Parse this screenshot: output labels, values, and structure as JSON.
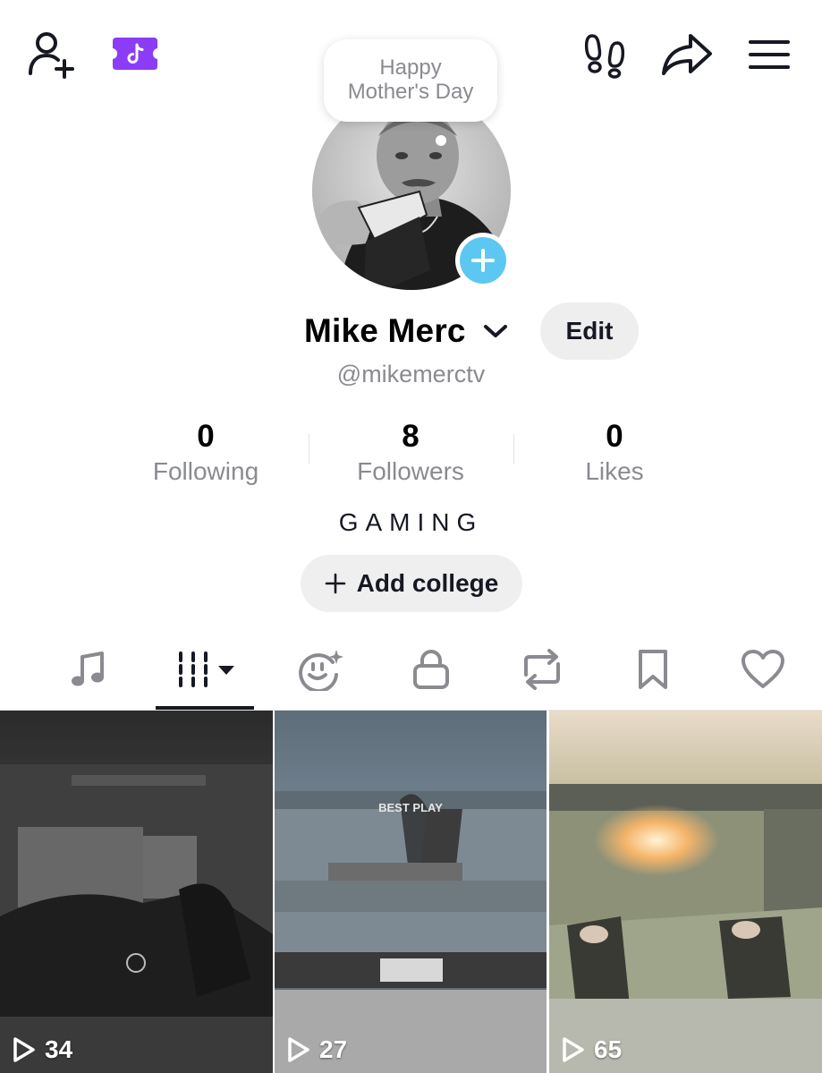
{
  "header": {
    "add_friend_icon": "person-plus-icon",
    "badge_icon": "tiktok-ticket-icon",
    "footprints_icon": "footprints-icon",
    "share_icon": "share-arrow-icon",
    "menu_icon": "hamburger-menu-icon"
  },
  "note_bubble": {
    "line1": "Happy",
    "line2": "Mother's Day"
  },
  "profile": {
    "display_name": "Mike Merc",
    "handle": "@mikemerctv",
    "edit_label": "Edit",
    "bio": "GAMING",
    "add_college_label": "Add college",
    "plus_color": "#5CC8F2"
  },
  "stats": [
    {
      "value": "0",
      "label": "Following"
    },
    {
      "value": "8",
      "label": "Followers"
    },
    {
      "value": "0",
      "label": "Likes"
    }
  ],
  "tabs": [
    {
      "icon": "music-note-icon"
    },
    {
      "icon": "videos-grid-icon",
      "active": true
    },
    {
      "icon": "ai-face-icon"
    },
    {
      "icon": "lock-icon"
    },
    {
      "icon": "repost-icon"
    },
    {
      "icon": "bookmark-icon"
    },
    {
      "icon": "heart-icon"
    }
  ],
  "videos": [
    {
      "views": "34"
    },
    {
      "views": "27",
      "overlay_text": "BEST PLAY"
    },
    {
      "views": "65"
    }
  ],
  "colors": {
    "badge_purple": "#8B3CF7",
    "secondary_text": "#8A8B91"
  }
}
